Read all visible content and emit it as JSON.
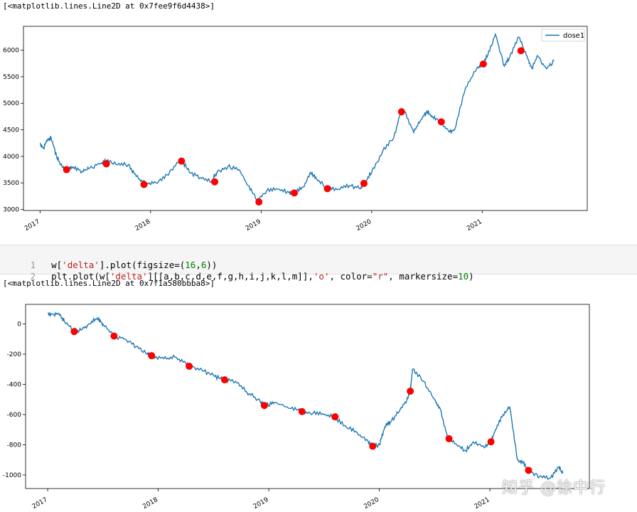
{
  "outputs": [
    {
      "text": "[<matplotlib.lines.Line2D at 0x7fee9f6d4438>]"
    },
    {
      "text": "[<matplotlib.lines.Line2D at 0x7f1a580bbba8>]"
    }
  ],
  "code_cell": {
    "lines": [
      {
        "number": "1",
        "code": "w['delta'].plot(figsize=(16,6))"
      },
      {
        "number": "2",
        "code": "plt.plot(w['delta'][[a,b,c,d,e,f,g,h,i,j,k,l,m]],'o', color=\"r\", markersize=10)"
      }
    ]
  },
  "watermark": "知乎 @徐中行",
  "chart_data": [
    {
      "type": "line",
      "title": "",
      "xlabel": "",
      "ylabel": "",
      "x_tick_labels": [
        "2017",
        "2018",
        "2019",
        "2020",
        "2021"
      ],
      "y_ticks": [
        3000,
        3500,
        4000,
        4500,
        5000,
        5500,
        6000
      ],
      "xlim": [
        2016.85,
        2021.95
      ],
      "ylim": [
        2980,
        6450
      ],
      "legend": {
        "position": "top-right",
        "entries": [
          "dose1"
        ]
      },
      "line_color": "#1f77b4",
      "marker_color": "#ff0000",
      "series": [
        {
          "name": "dose1",
          "x": [
            2017.0,
            2017.03,
            2017.06,
            2017.1,
            2017.15,
            2017.2,
            2017.25,
            2017.3,
            2017.38,
            2017.45,
            2017.55,
            2017.6,
            2017.7,
            2017.8,
            2017.87,
            2017.95,
            2018.05,
            2018.15,
            2018.25,
            2018.28,
            2018.35,
            2018.45,
            2018.55,
            2018.6,
            2018.7,
            2018.8,
            2018.88,
            2018.96,
            2019.05,
            2019.15,
            2019.25,
            2019.3,
            2019.38,
            2019.45,
            2019.5,
            2019.6,
            2019.7,
            2019.8,
            2019.9,
            2019.93,
            2020.0,
            2020.1,
            2020.2,
            2020.27,
            2020.3,
            2020.38,
            2020.45,
            2020.5,
            2020.55,
            2020.62,
            2020.7,
            2020.75,
            2020.85,
            2020.95,
            2021.0,
            2021.05,
            2021.12,
            2021.2,
            2021.25,
            2021.33,
            2021.4,
            2021.45,
            2021.5,
            2021.58,
            2021.65
          ],
          "y": [
            4250,
            4150,
            4300,
            4350,
            4000,
            3800,
            3750,
            3800,
            3720,
            3780,
            3870,
            3920,
            3840,
            3850,
            3620,
            3490,
            3500,
            3650,
            3880,
            3940,
            3700,
            3600,
            3520,
            3700,
            3810,
            3750,
            3450,
            3180,
            3350,
            3380,
            3320,
            3310,
            3420,
            3700,
            3580,
            3400,
            3380,
            3450,
            3390,
            3500,
            3700,
            4100,
            4350,
            4900,
            4840,
            4450,
            4700,
            4850,
            4750,
            4650,
            4460,
            4500,
            5300,
            5650,
            5740,
            5900,
            6300,
            5700,
            5880,
            6250,
            5900,
            5650,
            5900,
            5650,
            5800
          ]
        }
      ],
      "markers": {
        "x": [
          2017.24,
          2017.6,
          2017.94,
          2018.28,
          2018.58,
          2018.98,
          2019.3,
          2019.6,
          2019.93,
          2020.27,
          2020.63,
          2021.01,
          2021.35
        ],
        "y": [
          3750,
          3860,
          3470,
          3910,
          3520,
          3140,
          3310,
          3390,
          3490,
          4840,
          4650,
          5740,
          5990
        ]
      }
    },
    {
      "type": "line",
      "title": "",
      "xlabel": "",
      "ylabel": "",
      "x_tick_labels": [
        "2017",
        "2018",
        "2019",
        "2020",
        "2021"
      ],
      "y_ticks": [
        0,
        -200,
        -400,
        -600,
        -800,
        -1000
      ],
      "xlim": [
        2016.8,
        2021.9
      ],
      "ylim": [
        -1090,
        130
      ],
      "line_color": "#1f77b4",
      "marker_color": "#ff0000",
      "series": [
        {
          "name": "",
          "x": [
            2017.0,
            2017.05,
            2017.1,
            2017.15,
            2017.24,
            2017.3,
            2017.38,
            2017.45,
            2017.5,
            2017.6,
            2017.7,
            2017.8,
            2017.9,
            2017.94,
            2018.05,
            2018.15,
            2018.25,
            2018.28,
            2018.4,
            2018.5,
            2018.58,
            2018.7,
            2018.8,
            2018.9,
            2018.98,
            2019.05,
            2019.2,
            2019.3,
            2019.4,
            2019.5,
            2019.6,
            2019.7,
            2019.8,
            2019.9,
            2019.94,
            2020.0,
            2020.05,
            2020.1,
            2020.18,
            2020.25,
            2020.28,
            2020.3,
            2020.4,
            2020.5,
            2020.55,
            2020.62,
            2020.7,
            2020.78,
            2020.85,
            2020.95,
            2021.01,
            2021.05,
            2021.12,
            2021.18,
            2021.25,
            2021.3,
            2021.35,
            2021.45,
            2021.55,
            2021.62,
            2021.66
          ],
          "y": [
            70,
            65,
            70,
            20,
            -50,
            -40,
            0,
            40,
            0,
            -80,
            -100,
            -150,
            -200,
            -210,
            -230,
            -220,
            -260,
            -280,
            -310,
            -340,
            -370,
            -380,
            -450,
            -500,
            -540,
            -520,
            -560,
            -580,
            -590,
            -600,
            -620,
            -680,
            -720,
            -780,
            -810,
            -800,
            -680,
            -650,
            -580,
            -500,
            -440,
            -300,
            -380,
            -500,
            -560,
            -760,
            -800,
            -840,
            -780,
            -820,
            -780,
            -700,
            -600,
            -550,
            -900,
            -920,
            -970,
            -1010,
            -1020,
            -950,
            -990
          ]
        }
      ],
      "markers": {
        "x": [
          2017.24,
          2017.6,
          2017.94,
          2018.28,
          2018.6,
          2018.96,
          2019.3,
          2019.6,
          2019.94,
          2020.28,
          2020.63,
          2021.01,
          2021.35
        ],
        "y": [
          -50,
          -80,
          -210,
          -280,
          -370,
          -540,
          -580,
          -615,
          -810,
          -445,
          -760,
          -780,
          -970
        ]
      }
    }
  ]
}
